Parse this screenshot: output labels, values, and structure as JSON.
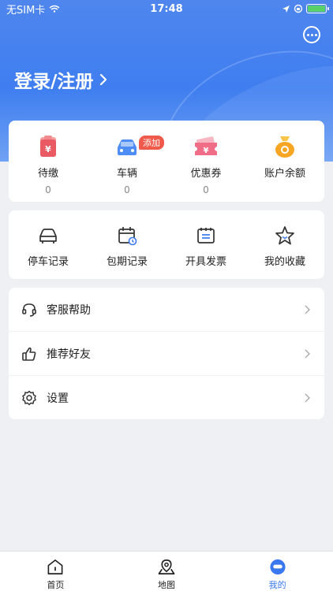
{
  "status": {
    "carrier": "无SIM卡",
    "time": "17:48"
  },
  "header": {
    "login": "登录/注册",
    "more_icon": "more-icon"
  },
  "wallet": [
    {
      "label": "待缴",
      "value": "0"
    },
    {
      "label": "车辆",
      "value": "0",
      "badge": "添加"
    },
    {
      "label": "优惠券",
      "value": "0"
    },
    {
      "label": "账户余额",
      "value": ""
    }
  ],
  "records": [
    {
      "label": "停车记录"
    },
    {
      "label": "包期记录"
    },
    {
      "label": "开具发票"
    },
    {
      "label": "我的收藏"
    }
  ],
  "menu": [
    {
      "label": "客服帮助"
    },
    {
      "label": "推荐好友"
    },
    {
      "label": "设置"
    }
  ],
  "tabs": [
    {
      "label": "首页"
    },
    {
      "label": "地图"
    },
    {
      "label": "我的"
    }
  ],
  "colors": {
    "accent": "#3a78f2",
    "badge": "#f05a4a",
    "hero": "#4f86ee"
  }
}
